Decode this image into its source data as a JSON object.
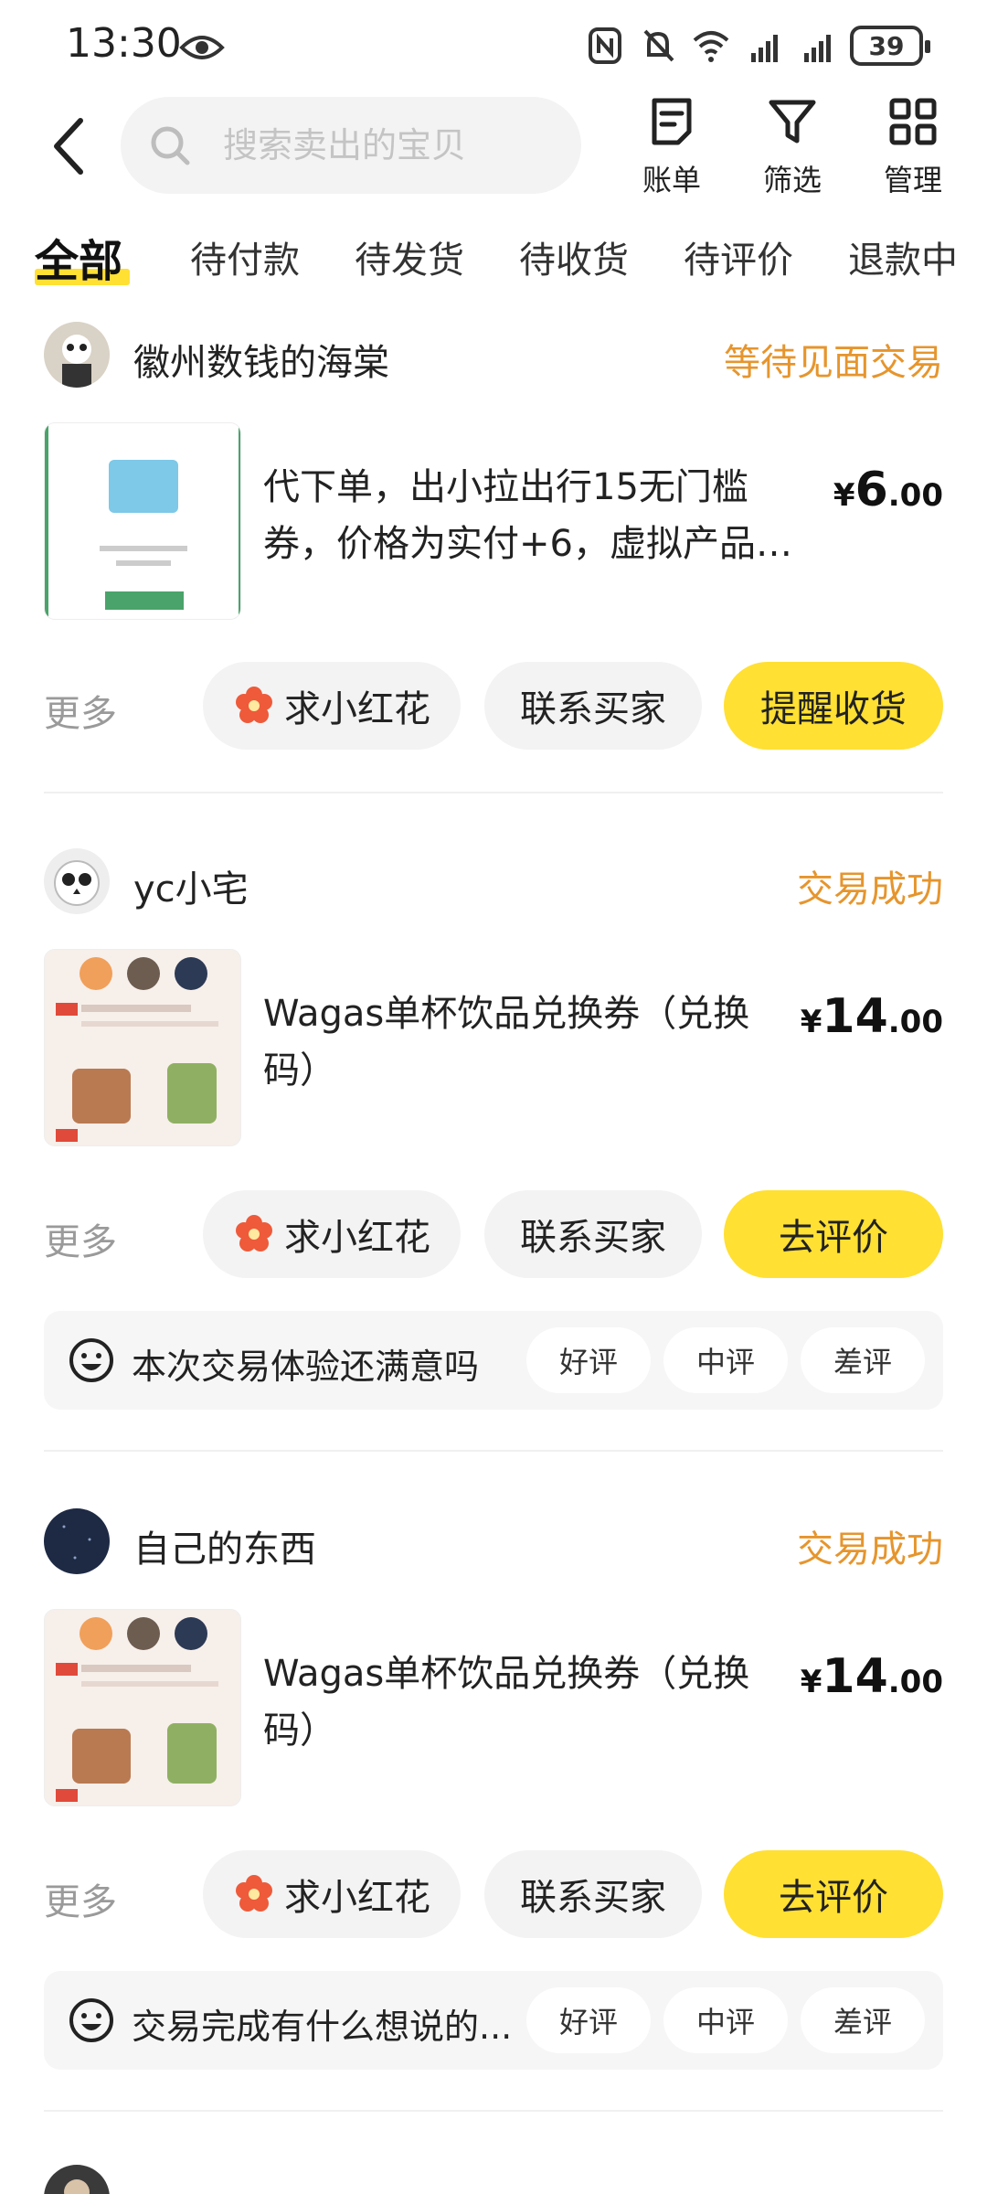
{
  "status_bar": {
    "time": "13:30",
    "battery": "39"
  },
  "header": {
    "search_placeholder": "搜索卖出的宝贝",
    "tools": [
      {
        "label": "账单",
        "icon": "bill-icon"
      },
      {
        "label": "筛选",
        "icon": "filter-icon"
      },
      {
        "label": "管理",
        "icon": "grid-icon"
      }
    ]
  },
  "tabs": [
    "全部",
    "待付款",
    "待发货",
    "待收货",
    "待评价",
    "退款中"
  ],
  "orders": [
    {
      "seller": "徽州数钱的海棠",
      "status": "等待见面交易",
      "title": "代下单，出小拉出行15无门槛券，价格为实付+6，虚拟产品…",
      "price_symbol": "¥",
      "price_int": "6",
      "price_dec": ".00",
      "more": "更多",
      "btn_flower": "求小红花",
      "btn_contact": "联系买家",
      "btn_primary": "提醒收货"
    },
    {
      "seller": "yc小宅",
      "status": "交易成功",
      "title": "Wagas单杯饮品兑换券（兑换码）",
      "price_symbol": "¥",
      "price_int": "14",
      "price_dec": ".00",
      "more": "更多",
      "btn_flower": "求小红花",
      "btn_contact": "联系买家",
      "btn_primary": "去评价",
      "review_question": "本次交易体验还满意吗",
      "review_options": [
        "好评",
        "中评",
        "差评"
      ]
    },
    {
      "seller": "自己的东西",
      "status": "交易成功",
      "title": "Wagas单杯饮品兑换券（兑换码）",
      "price_symbol": "¥",
      "price_int": "14",
      "price_dec": ".00",
      "more": "更多",
      "btn_flower": "求小红花",
      "btn_contact": "联系买家",
      "btn_primary": "去评价",
      "review_question": "交易完成有什么想说的...",
      "review_options": [
        "好评",
        "中评",
        "差评"
      ]
    }
  ],
  "colors": {
    "accent_yellow": "#ffe033",
    "status_orange": "#e6952d",
    "muted_gray": "#9a9a9a"
  }
}
